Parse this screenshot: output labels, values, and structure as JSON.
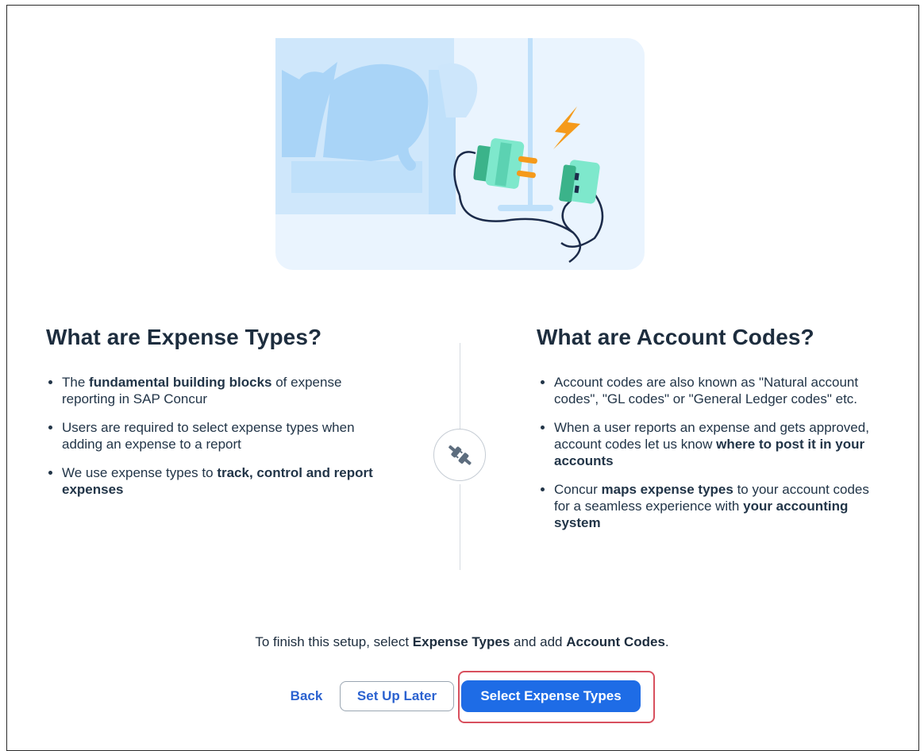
{
  "left": {
    "title": "What are Expense Types?",
    "bullets": [
      [
        "The ",
        "fundamental building blocks",
        " of expense reporting in SAP Concur"
      ],
      [
        "Users are required to select expense types when adding an expense to a report"
      ],
      [
        "We use expense types to ",
        "track, control and report expenses",
        ""
      ]
    ]
  },
  "right": {
    "title": "What are Account Codes?",
    "bullets": [
      [
        "Account codes are also known as \"Natural account codes\", \"GL codes\" or \"General Ledger codes\" etc."
      ],
      [
        "When a user reports an expense and gets approved, account codes let us know ",
        "where to post it in your accounts",
        ""
      ],
      [
        "Concur ",
        "maps expense types",
        " to your account codes for a seamless experience with ",
        "your accounting system",
        ""
      ]
    ]
  },
  "footer": {
    "finish_pre": "To finish this setup, select ",
    "finish_b1": "Expense Types",
    "finish_mid": " and add ",
    "finish_b2": "Account Codes",
    "finish_post": "."
  },
  "buttons": {
    "back": "Back",
    "later": "Set Up Later",
    "select": "Select Expense Types"
  },
  "icons": {
    "illustration": "unplugged-plug-illustration",
    "divider": "plug-disconnect-icon"
  },
  "colors": {
    "primary": "#1e6ce6",
    "link": "#2b62d0",
    "highlight": "#d8505e",
    "text": "#1d2d3e"
  }
}
